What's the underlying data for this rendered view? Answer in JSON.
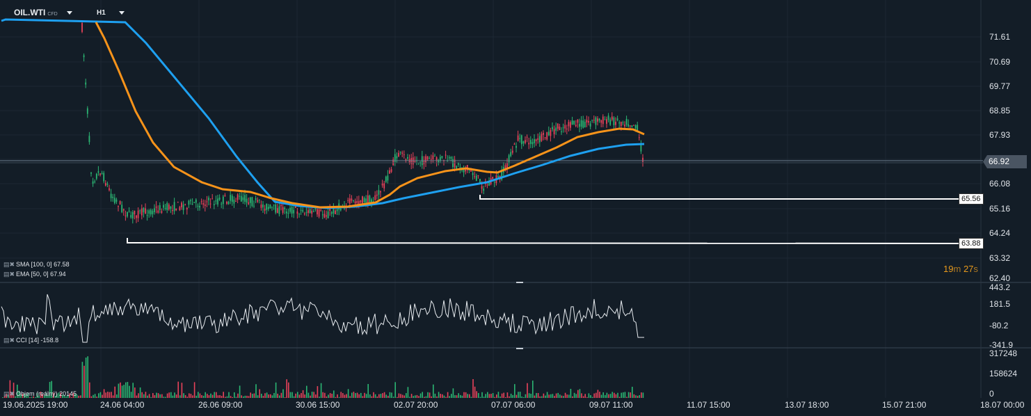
{
  "header": {
    "symbol": "OIL.WTI",
    "symbol_type": "CFD",
    "timeframe": "H1"
  },
  "price_axis": [
    "71.61",
    "70.69",
    "69.77",
    "68.85",
    "67.93",
    "66.08",
    "65.16",
    "64.24",
    "63.32",
    "62.40"
  ],
  "current_price": "66.92",
  "levels": [
    {
      "label": "65.56"
    },
    {
      "label": "63.88"
    }
  ],
  "countdown": {
    "minutes": "19",
    "minutes_unit": "m",
    "seconds": "27",
    "seconds_unit": "s"
  },
  "indicators": {
    "sma": "SMA [100, 0] 67.58",
    "ema": "EMA [50, 0] 67.94",
    "cci": "CCI [14] -158.8",
    "volume": "Objem (reálný) 20145"
  },
  "cci_axis": [
    "443.2",
    "181.5",
    "-80.2",
    "-341.9"
  ],
  "volume_axis": [
    "317248",
    "158624",
    "0"
  ],
  "time_axis": [
    "19.06.2025  19:00",
    "24.06  04:00",
    "26.06  09:00",
    "30.06  15:00",
    "02.07  20:00",
    "07.07  06:00",
    "09.07  11:00",
    "11.07  15:00",
    "13.07  18:00",
    "15.07  21:00",
    "18.07  00:00"
  ],
  "colors": {
    "background": "#131d27",
    "sma": "#1ea0f0",
    "ema": "#f7931a",
    "up_candle": "#2bb673",
    "down_candle": "#e8425a",
    "countdown": "#e89a1c"
  }
}
